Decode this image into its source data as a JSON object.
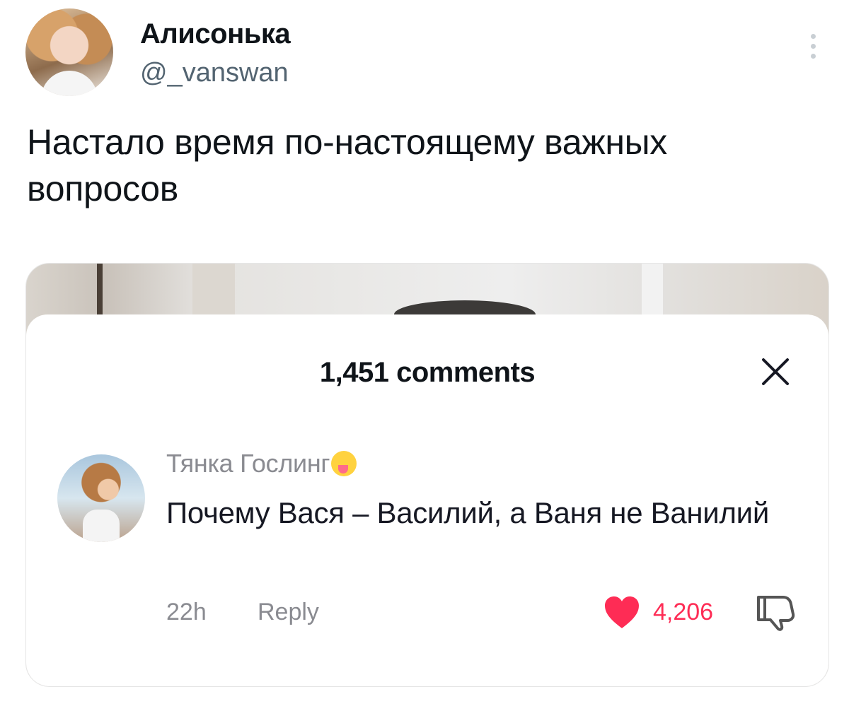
{
  "tweet": {
    "author": {
      "display_name": "Алисонька",
      "handle": "@_vanswan"
    },
    "text": "Настало время по-настоящему важных вопросов"
  },
  "media": {
    "comments_panel": {
      "title": "1,451 comments",
      "comment": {
        "username": "Тянка Гослинг",
        "emoji": "😜",
        "text": "Почему Вася – Василий, а Ваня не Ванилий",
        "time": "22h",
        "reply_label": "Reply",
        "likes": "4,206"
      }
    }
  },
  "colors": {
    "text": "#0f1419",
    "secondary": "#536471",
    "comment_meta": "#8a8b91",
    "heart": "#fe2c55"
  },
  "icons": [
    "more-vertical-icon",
    "close-icon",
    "heart-icon",
    "dislike-icon"
  ]
}
